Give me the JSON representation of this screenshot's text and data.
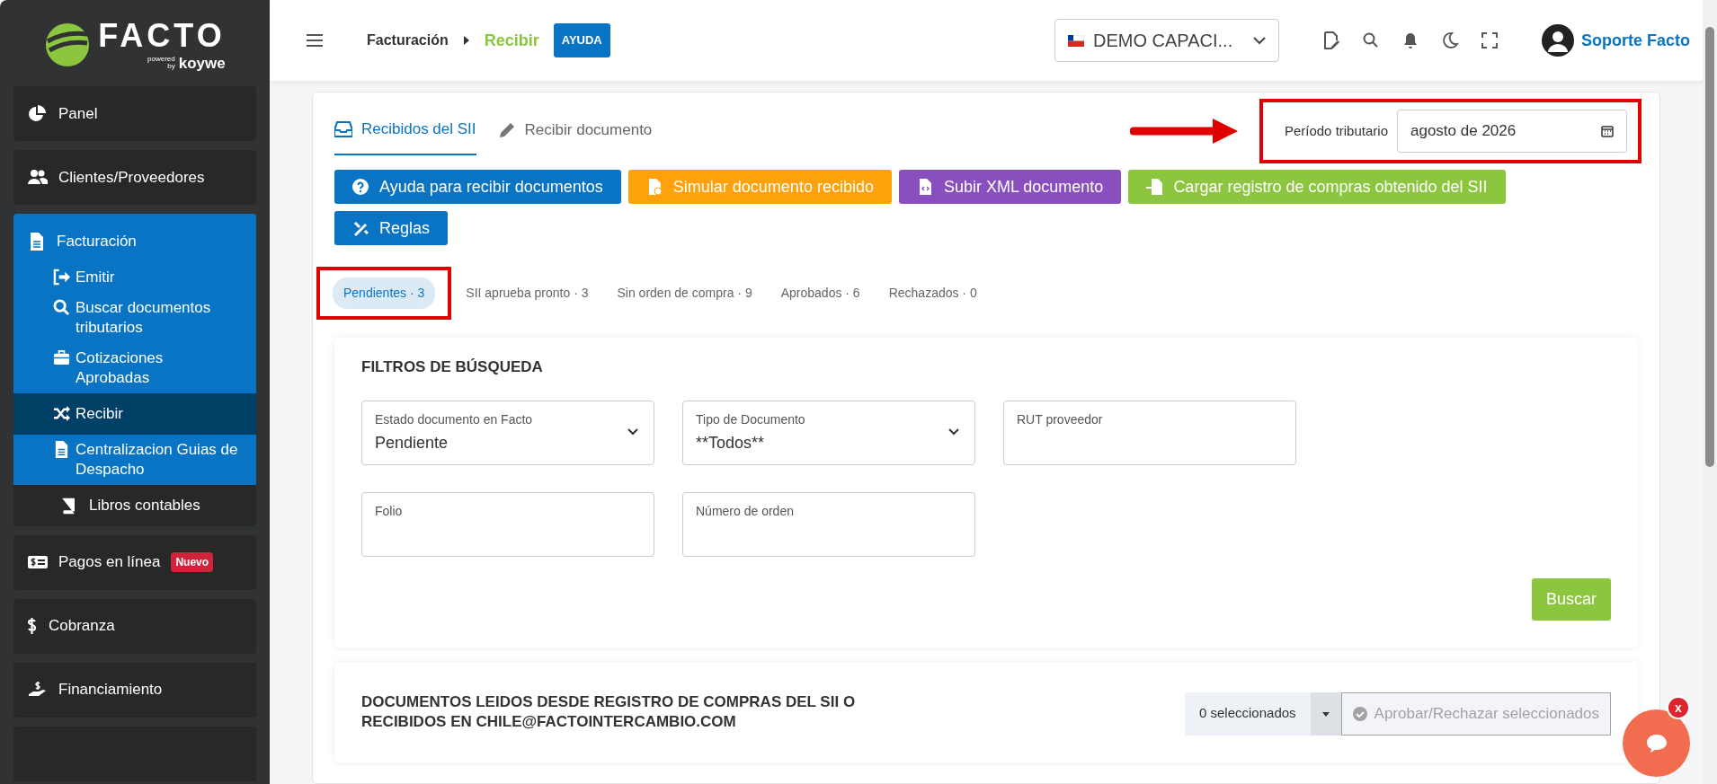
{
  "logo": {
    "name": "FACTO",
    "powered": "powered",
    "by": "by",
    "brand": "koywe"
  },
  "sidebar": {
    "items": [
      {
        "label": "Panel",
        "expanded": false
      },
      {
        "label": "Clientes/Proveedores",
        "expanded": false
      },
      {
        "label": "Facturación",
        "expanded": true,
        "children": [
          {
            "label": "Emitir",
            "selected": false,
            "kind": "link"
          },
          {
            "label": "Buscar documentos tributarios",
            "selected": false,
            "kind": "link"
          },
          {
            "label": "Cotizaciones Aprobadas",
            "selected": false,
            "kind": "link"
          },
          {
            "label": "Recibir",
            "selected": true,
            "kind": "link"
          },
          {
            "label": "Centralizacion Guias de Despacho",
            "selected": false,
            "kind": "link"
          },
          {
            "label": "Libros contables",
            "selected": false,
            "kind": "nested"
          }
        ]
      },
      {
        "label": "Pagos en línea",
        "badge": "Nuevo",
        "expanded": false
      },
      {
        "label": "Cobranza",
        "expanded": false
      },
      {
        "label": "Financiamiento",
        "expanded": false
      }
    ]
  },
  "header": {
    "breadcrumb": [
      "Facturación",
      "Recibir"
    ],
    "help": "AYUDA",
    "company": "DEMO CAPACI...",
    "user": "Soporte Facto"
  },
  "tabs": [
    {
      "label": "Recibidos del SII",
      "selected": true
    },
    {
      "label": "Recibir documento",
      "selected": false
    }
  ],
  "period": {
    "label": "Período tributario",
    "value": "agosto de 2026"
  },
  "actions": [
    {
      "label": "Ayuda para recibir documentos",
      "color": "#0a74c4"
    },
    {
      "label": "Simular documento recibido",
      "color": "#ffa10a"
    },
    {
      "label": "Subir XML documento",
      "color": "#8a4fbf"
    },
    {
      "label": "Cargar registro de compras obtenido del SII",
      "color": "#8cc63f"
    },
    {
      "label": "Reglas",
      "color": "#0a74c4"
    }
  ],
  "status_tabs": [
    {
      "label": "Pendientes · 3",
      "selected": true
    },
    {
      "label": "SII aprueba pronto · 3",
      "selected": false
    },
    {
      "label": "Sin orden de compra · 9",
      "selected": false
    },
    {
      "label": "Aprobados · 6",
      "selected": false
    },
    {
      "label": "Rechazados · 0",
      "selected": false
    }
  ],
  "filters": {
    "title": "FILTROS DE BÚSQUEDA",
    "fields": [
      {
        "label": "Estado documento en Facto",
        "value": "Pendiente",
        "kind": "select"
      },
      {
        "label": "Tipo de Documento",
        "value": "**Todos**",
        "kind": "select"
      },
      {
        "label": "RUT proveedor",
        "kind": "text"
      },
      {
        "label": "Folio",
        "kind": "text"
      },
      {
        "label": "Número de orden",
        "kind": "text"
      }
    ],
    "search": "Buscar"
  },
  "documents": {
    "title": "DOCUMENTOS LEIDOS DESDE REGISTRO DE COMPRAS DEL SII O RECIBIDOS EN CHILE@FACTOINTERCAMBIO.COM",
    "selected_count": "0 seleccionados",
    "bulk_action": "Aprobar/Rechazar seleccionados",
    "bulk_disabled": true
  },
  "chat": {
    "close": "x"
  }
}
